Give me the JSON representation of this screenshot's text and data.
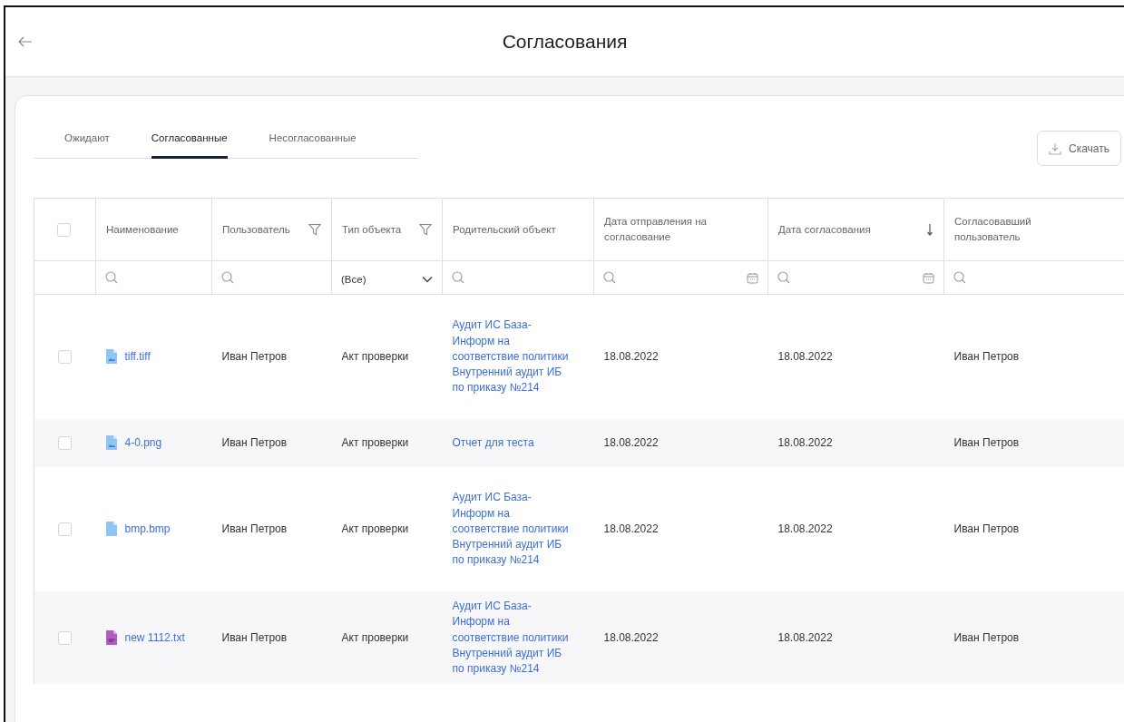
{
  "header": {
    "title": "Согласования"
  },
  "tabs": [
    {
      "label": "Ожидают",
      "selected": false
    },
    {
      "label": "Согласованные",
      "selected": true
    },
    {
      "label": "Несогласованные",
      "selected": false
    }
  ],
  "download_button": {
    "label": "Скачать"
  },
  "table": {
    "select_all": {
      "checked": false
    },
    "columns": [
      {
        "label": "Наименование",
        "filter": false,
        "sorted": false
      },
      {
        "label": "Пользователь",
        "filter": true,
        "sorted": false
      },
      {
        "label": "Тип объекта",
        "filter": true,
        "sorted": false
      },
      {
        "label": "Родительский объект",
        "filter": false,
        "sorted": false
      },
      {
        "label": "Дата отправления на согласование",
        "filter": false,
        "sorted": false
      },
      {
        "label": "Дата согласования",
        "filter": false,
        "sorted": true
      },
      {
        "label": "Согласовавший пользователь",
        "filter": false,
        "sorted": false
      }
    ],
    "filter_row": [
      {
        "kind": "search"
      },
      {
        "kind": "search"
      },
      {
        "kind": "select",
        "value": "(Все)"
      },
      {
        "kind": "search"
      },
      {
        "kind": "date"
      },
      {
        "kind": "date"
      },
      {
        "kind": "search"
      }
    ],
    "rows": [
      {
        "checked": false,
        "file": {
          "name": "tiff.tiff",
          "kind": "image"
        },
        "user": "Иван Петров",
        "type": "Акт проверки",
        "parent": "Аудит ИС База-Информ на соответствие политики Внутренний аудит ИБ по приказу №214",
        "sent": "18.08.2022",
        "approved": "18.08.2022",
        "approver": "Иван Петров"
      },
      {
        "checked": false,
        "file": {
          "name": "4-0.png",
          "kind": "image"
        },
        "user": "Иван Петров",
        "type": "Акт проверки",
        "parent": "Отчет для теста",
        "sent": "18.08.2022",
        "approved": "18.08.2022",
        "approver": "Иван Петров"
      },
      {
        "checked": false,
        "file": {
          "name": "bmp.bmp",
          "kind": "plain"
        },
        "user": "Иван Петров",
        "type": "Акт проверки",
        "parent": "Аудит ИС База-Информ на соответствие политики Внутренний аудит ИБ по приказу №214",
        "sent": "18.08.2022",
        "approved": "18.08.2022",
        "approver": "Иван Петров"
      },
      {
        "checked": false,
        "file": {
          "name": "new 1112.txt",
          "kind": "text"
        },
        "user": "Иван Петров",
        "type": "Акт проверки",
        "parent": "Аудит ИС База-Информ на соответствие политики Внутренний аудит ИБ по приказу №214",
        "sent": "18.08.2022",
        "approved": "18.08.2022",
        "approver": "Иван Петров"
      }
    ]
  }
}
